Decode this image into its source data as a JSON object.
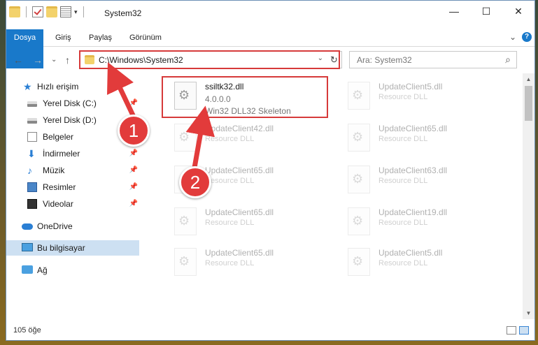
{
  "window": {
    "title": "System32"
  },
  "quick_access_toolbar": {
    "icons": [
      "folder-icon",
      "properties-check-icon",
      "folder-icon",
      "properties-icon",
      "dropdown-arrow-icon"
    ]
  },
  "window_controls": {
    "minimize": "—",
    "maximize": "☐",
    "close": "✕"
  },
  "ribbon": {
    "tabs": [
      {
        "label": "Dosya"
      },
      {
        "label": "Giriş"
      },
      {
        "label": "Paylaş"
      },
      {
        "label": "Görünüm"
      }
    ],
    "expand_icon": "⌄",
    "help_icon": "?"
  },
  "nav": {
    "back": "←",
    "forward": "→",
    "recent": "⌄",
    "up": "↑",
    "address": "C:\\Windows\\System32",
    "address_dropdown": "⌄",
    "refresh": "↻",
    "search_placeholder": "Ara: System32",
    "search_icon": "⌕"
  },
  "sidebar": {
    "items": [
      {
        "label": "Hızlı erişim",
        "icon": "star-icon",
        "pinned": false
      },
      {
        "label": "Yerel Disk (C:)",
        "icon": "drive-icon",
        "pinned": true
      },
      {
        "label": "Yerel Disk (D:)",
        "icon": "drive-icon",
        "pinned": false
      },
      {
        "label": "Belgeler",
        "icon": "documents-icon",
        "pinned": true
      },
      {
        "label": "İndirmeler",
        "icon": "downloads-icon",
        "pinned": true
      },
      {
        "label": "Müzik",
        "icon": "music-icon",
        "pinned": true
      },
      {
        "label": "Resimler",
        "icon": "pictures-icon",
        "pinned": true
      },
      {
        "label": "Videolar",
        "icon": "videos-icon",
        "pinned": true
      },
      {
        "label": "OneDrive",
        "icon": "onedrive-icon",
        "pinned": false
      },
      {
        "label": "Bu bilgisayar",
        "icon": "this-pc-icon",
        "pinned": false,
        "selected": true
      },
      {
        "label": "Ağ",
        "icon": "network-icon",
        "pinned": false
      }
    ],
    "pin_glyph": "📌"
  },
  "files": [
    {
      "name": "ssiltk32.dll",
      "line2": "4.0.0.0",
      "line3": "Win32 DLL32 Skeleton",
      "highlighted": true
    },
    {
      "name": "UpdateClient5.dll",
      "line2": "Resource DLL"
    },
    {
      "name": "UpdateClient42.dll",
      "line2": "Resource DLL"
    },
    {
      "name": "UpdateClient65.dll",
      "line2": "Resource DLL"
    },
    {
      "name": "UpdateClient65.dll",
      "line2": "Resource DLL"
    },
    {
      "name": "UpdateClient63.dll",
      "line2": "Resource DLL"
    },
    {
      "name": "UpdateClient65.dll",
      "line2": "Resource DLL"
    },
    {
      "name": "UpdateClient19.dll",
      "line2": "Resource DLL"
    },
    {
      "name": "UpdateClient65.dll",
      "line2": "Resource DLL"
    },
    {
      "name": "UpdateClient5.dll",
      "line2": "Resource DLL"
    }
  ],
  "status": {
    "item_count": "105 öğe"
  },
  "callouts": {
    "one": "1",
    "two": "2"
  },
  "colors": {
    "accent": "#1979ca",
    "highlight": "#d63a3a",
    "callout": "#e23b3b",
    "selected": "#cde0f2"
  }
}
